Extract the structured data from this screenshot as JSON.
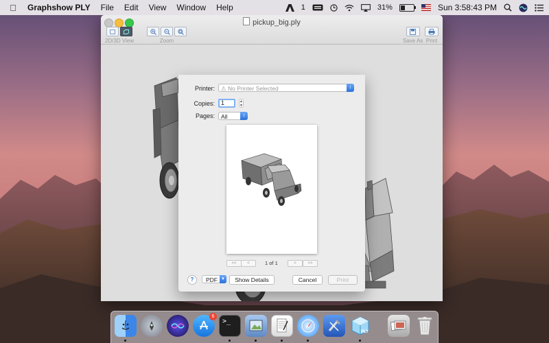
{
  "menubar": {
    "apple_icon": "apple-logo-icon",
    "app_name": "Graphshow PLY",
    "items": [
      "File",
      "Edit",
      "View",
      "Window",
      "Help"
    ],
    "status": {
      "adobe_count": "1",
      "battery_percent": "31%",
      "battery_level": 0.31,
      "clock": "Sun 3:58:43 PM"
    }
  },
  "window": {
    "title": "pickup_big.ply",
    "toolbar": {
      "view_label": "2D/3D View",
      "zoom_label": "Zoom",
      "save_label": "Save As",
      "print_label": "Print"
    }
  },
  "print_dialog": {
    "printer_label": "Printer:",
    "printer_value": "⚠ No Printer Selected",
    "copies_label": "Copies:",
    "copies_value": "1",
    "pages_label": "Pages:",
    "pages_value": "All",
    "pagination": {
      "first": "<<",
      "prev": "<",
      "next": ">",
      "last": ">>",
      "page_text": "1 of 1"
    },
    "help": "?",
    "pdf": "PDF",
    "show_details": "Show Details",
    "cancel": "Cancel",
    "print": "Print"
  },
  "dock": {
    "items": [
      {
        "name": "finder-icon",
        "color": "#3d8cf0"
      },
      {
        "name": "launchpad-icon",
        "color": "#8f98a6"
      },
      {
        "name": "siri-icon",
        "color": "#4b3bd4"
      },
      {
        "name": "app-store-icon",
        "color": "#1d8ff2",
        "badge": "6"
      },
      {
        "name": "terminal-icon",
        "color": "#1e1e1e"
      },
      {
        "name": "preview-icon",
        "color": "#7aa3d6"
      },
      {
        "name": "textedit-icon",
        "color": "#f1f1f1"
      },
      {
        "name": "safari-icon",
        "color": "#2b8ef4"
      },
      {
        "name": "xcode-icon",
        "color": "#3c78d8"
      },
      {
        "name": "graphshow-ply-icon",
        "color": "#5cb7e8"
      },
      {
        "name": "photos-stack-icon",
        "color": "#c9c9c9"
      },
      {
        "name": "trash-icon",
        "color": "#c7c7c7"
      }
    ]
  }
}
